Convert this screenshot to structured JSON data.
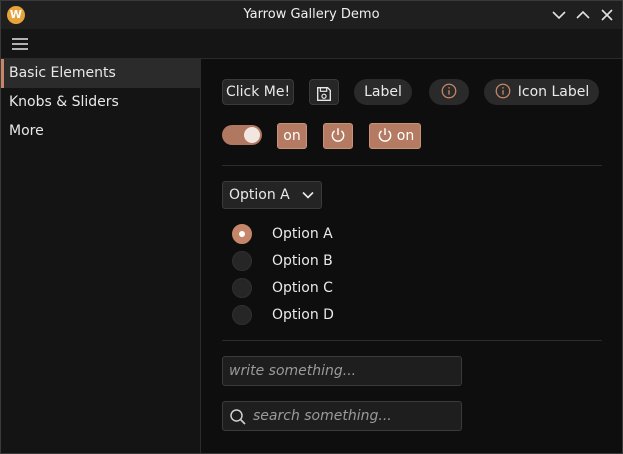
{
  "window": {
    "title": "Yarrow Gallery Demo",
    "logo_letter": "W",
    "accent": "#c58669",
    "controls": [
      "chevron-down-icon",
      "chevron-up-icon",
      "close-icon"
    ]
  },
  "toolbar": {
    "menu_icon": "hamburger-icon"
  },
  "sidebar": {
    "items": [
      {
        "label": "Basic Elements",
        "active": true
      },
      {
        "label": "Knobs & Sliders",
        "active": false
      },
      {
        "label": "More",
        "active": false
      }
    ]
  },
  "buttons": {
    "click_me": "Click Me!",
    "save_icon": "save-icon",
    "label_pill": "Label",
    "info_icon": "info-icon",
    "icon_label": "Icon Label"
  },
  "toggles": {
    "switch_on": true,
    "on_text": "on",
    "power_icon": "power-icon",
    "power_on_text": "on"
  },
  "dropdown": {
    "selected": "Option A"
  },
  "radios": {
    "options": [
      {
        "label": "Option A",
        "checked": true
      },
      {
        "label": "Option B",
        "checked": false
      },
      {
        "label": "Option C",
        "checked": false
      },
      {
        "label": "Option D",
        "checked": false
      }
    ]
  },
  "inputs": {
    "write_placeholder": "write something...",
    "search_placeholder": "search something..."
  }
}
